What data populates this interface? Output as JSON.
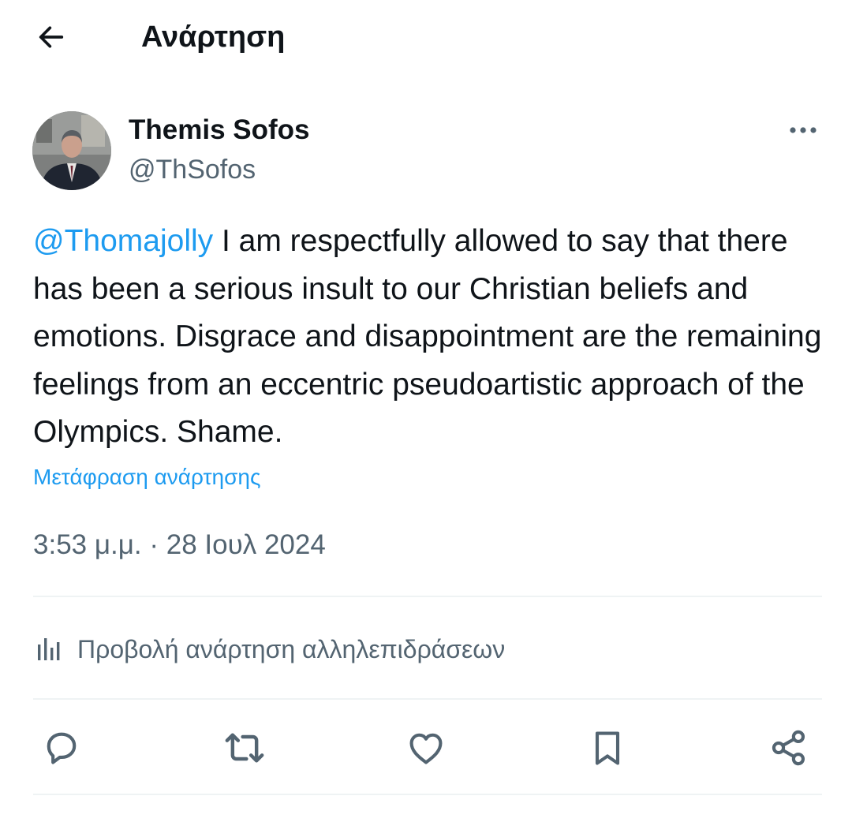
{
  "header": {
    "title": "Ανάρτηση",
    "back_icon": "arrow-left-icon"
  },
  "author": {
    "name": "Themis Sofos",
    "handle": "@ThSofos"
  },
  "post": {
    "mention": "@Thomajolly",
    "text": " I am respectfully allowed to say that there has been a serious insult to our Christian beliefs and emotions. Disgrace and disappointment are the remaining feelings from an eccentric pseudoartistic approach of the Olympics. Shame.",
    "translate_label": "Μετάφραση ανάρτησης",
    "time": "3:53 μ.μ.",
    "separator": " · ",
    "date": "28 Ιουλ 2024"
  },
  "analytics": {
    "label": "Προβολή ανάρτηση αλληλεπιδράσεων",
    "icon": "analytics-bars-icon"
  },
  "actions": [
    "reply-icon",
    "repost-icon",
    "like-icon",
    "bookmark-icon",
    "share-icon"
  ],
  "colors": {
    "accent": "#1d9bf0",
    "text": "#0f1419",
    "secondary": "#536471",
    "divider": "#eff3f4"
  }
}
